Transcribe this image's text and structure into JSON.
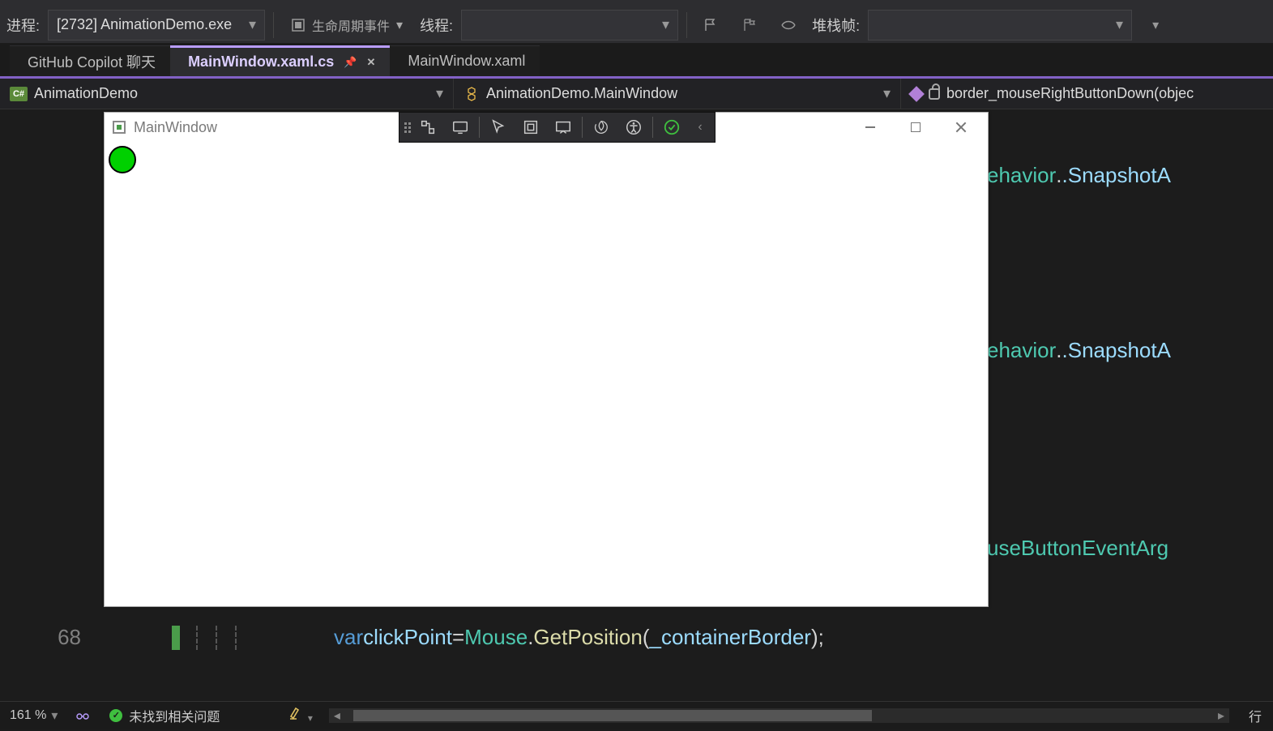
{
  "debugBar": {
    "processLabel": "进程:",
    "processValue": "[2732] AnimationDemo.exe",
    "lifecycleLabel": "生命周期事件",
    "threadLabel": "线程:",
    "threadValue": "",
    "stackframeLabel": "堆栈帧:",
    "stackframeValue": ""
  },
  "tabs": {
    "copilot": "GitHub Copilot 聊天",
    "active": "MainWindow.xaml.cs",
    "xaml": "MainWindow.xaml"
  },
  "navigator": {
    "seg1": "AnimationDemo",
    "seg2": "AnimationDemo.MainWindow",
    "seg3": "border_mouseRightButtonDown(objec"
  },
  "code": {
    "frag1a": "ehavior",
    "frag1b": ".SnapshotA",
    "frag2a": "ehavior",
    "frag2b": ".SnapshotA",
    "frag3": "useButtonEventArg",
    "lineNum": "68",
    "line68_kw": "var",
    "line68_id": " clickPoint ",
    "line68_eq": "= ",
    "line68_typ": "Mouse",
    "line68_dot": ".",
    "line68_fn": "GetPosition",
    "line68_paren": "(",
    "line68_arg": "_containerBorder",
    "line68_end": ");"
  },
  "appWindow": {
    "title": "MainWindow"
  },
  "status": {
    "zoom": "161 %",
    "issues": "未找到相关问题",
    "lineInfo": "行"
  }
}
